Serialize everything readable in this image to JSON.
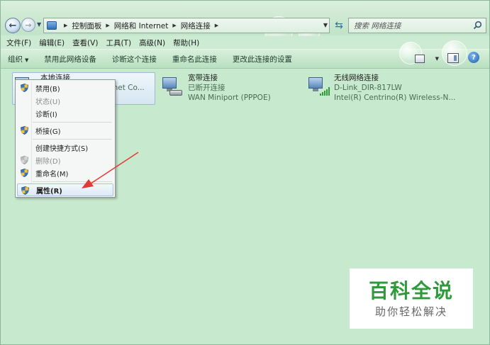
{
  "address": {
    "breadcrumb": [
      "控制面板",
      "网络和 Internet",
      "网络连接"
    ],
    "search_placeholder": "搜索 网络连接"
  },
  "menubar": [
    "文件(F)",
    "编辑(E)",
    "查看(V)",
    "工具(T)",
    "高级(N)",
    "帮助(H)"
  ],
  "commandbar": {
    "organize": "组织",
    "items": [
      "禁用此网络设备",
      "诊断这个连接",
      "重命名此连接",
      "更改此连接的设置"
    ]
  },
  "connections": [
    {
      "name": "本地连接",
      "status": "",
      "device": "ernet Co..."
    },
    {
      "name": "宽带连接",
      "status": "已断开连接",
      "device": "WAN Miniport (PPPOE)"
    },
    {
      "name": "无线网络连接",
      "status": "D-Link_DIR-817LW",
      "device": "Intel(R) Centrino(R) Wireless-N..."
    }
  ],
  "context_menu": {
    "items": [
      {
        "label": "禁用(B)",
        "shield": true,
        "disabled": false
      },
      {
        "label": "状态(U)",
        "shield": false,
        "disabled": true
      },
      {
        "label": "诊断(I)",
        "shield": false,
        "disabled": false
      },
      {
        "label": "桥接(G)",
        "shield": true,
        "disabled": false
      },
      {
        "label": "创建快捷方式(S)",
        "shield": false,
        "disabled": false
      },
      {
        "label": "删除(D)",
        "shield": true,
        "disabled": true
      },
      {
        "label": "重命名(M)",
        "shield": true,
        "disabled": false
      },
      {
        "label": "属性(R)",
        "shield": true,
        "disabled": false,
        "highlighted": true
      }
    ]
  },
  "watermark": {
    "title": "百科全说",
    "subtitle": "助你轻松解决"
  },
  "colors": {
    "background": "#c7e9cd",
    "arrow": "#e53935",
    "watermark_green": "#2f9a3b"
  }
}
